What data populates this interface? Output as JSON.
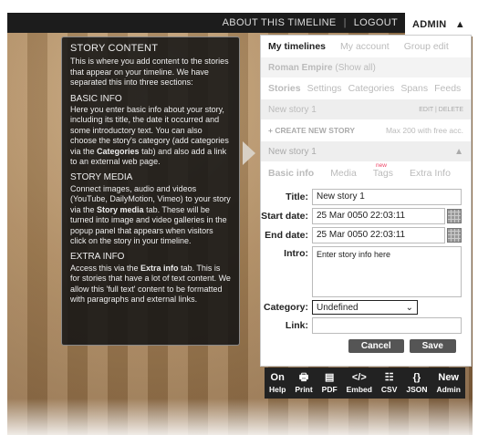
{
  "topbar": {
    "about_link": "ABOUT THIS TIMELINE",
    "separator": "|",
    "logout_link": "LOGOUT",
    "admin_tab": "ADMIN",
    "admin_caret": "▲"
  },
  "help": {
    "title": "STORY CONTENT",
    "intro": "This is where you add content to the stories that appear on your timeline. We have separated this into three sections:",
    "sections": [
      {
        "heading": "BASIC INFO",
        "text_before": "Here you enter basic info about your story, including its title, the date it occurred and some introductory text. You can also choose the story's category (add categories via the ",
        "bold": "Categories",
        "text_after": " tab) and also add a link to an external web page."
      },
      {
        "heading": "STORY MEDIA",
        "text_before": "Connect images, audio and videos (YouTube, DailyMotion, Vimeo) to your story via the ",
        "bold": "Story media",
        "text_after": " tab. These will be turned into image and video galleries in the popup panel that appears when visitors click on the story in your timeline."
      },
      {
        "heading": "EXTRA INFO",
        "text_before": "Access this via the ",
        "bold": "Extra info",
        "text_after": " tab. This is for stories that have a lot of text content. We allow this 'full text' content to be formatted with paragraphs and external links."
      }
    ]
  },
  "panel": {
    "nav": [
      "My timelines",
      "My account",
      "Group edit"
    ],
    "timeline_name": "Roman Empire",
    "show_all": "(Show all)",
    "tabs": [
      "Stories",
      "Settings",
      "Categories",
      "Spans",
      "Feeds"
    ],
    "existing_story": "New story 1",
    "edit_delete": "EDIT | DELETE",
    "create_story": "+ CREATE NEW STORY",
    "max_note": "Max 200 with free acc.",
    "current_story": "New story 1",
    "current_caret": "▲",
    "subtabs": [
      "Basic info",
      "Media",
      "Tags",
      "Extra Info"
    ],
    "new_badge": "new",
    "form": {
      "title_label": "Title:",
      "title_value": "New story 1",
      "start_label": "Start date:",
      "start_value": "25 Mar 0050 22:03:11",
      "end_label": "End date:",
      "end_value": "25 Mar 0050 22:03:11",
      "intro_label": "Intro:",
      "intro_value": "Enter story info here",
      "category_label": "Category:",
      "category_value": "Undefined",
      "link_label": "Link:",
      "link_value": "",
      "cancel": "Cancel",
      "save": "Save"
    }
  },
  "toolbar": [
    {
      "icon": "On",
      "label": "Help",
      "name": "help"
    },
    {
      "icon": "🖶",
      "label": "Print",
      "name": "print"
    },
    {
      "icon": "▤",
      "label": "PDF",
      "name": "pdf"
    },
    {
      "icon": "</>",
      "label": "Embed",
      "name": "embed"
    },
    {
      "icon": "☷",
      "label": "CSV",
      "name": "csv"
    },
    {
      "icon": "{}",
      "label": "JSON",
      "name": "json"
    },
    {
      "icon": "New",
      "label": "Admin",
      "name": "admin"
    }
  ]
}
